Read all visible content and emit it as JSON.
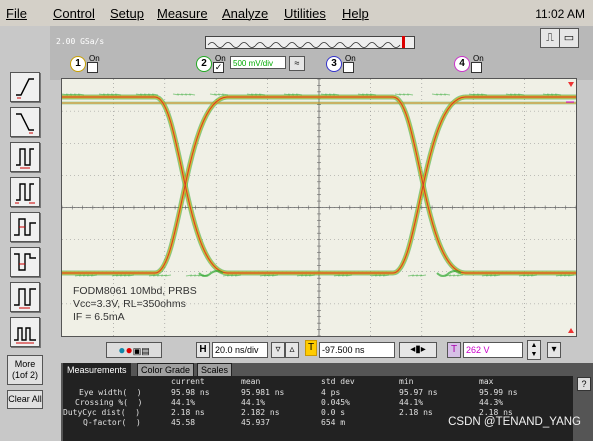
{
  "menu": [
    "File",
    "Control",
    "Setup",
    "Measure",
    "Analyze",
    "Utilities",
    "Help"
  ],
  "clock": "11:02 AM",
  "toolbar": {
    "sample_rate": "2.00 GSa/s",
    "channels": [
      {
        "num": "1",
        "on_label": "On",
        "checked": false
      },
      {
        "num": "2",
        "on_label": "On",
        "checked": true,
        "scale": "500 mV/div"
      },
      {
        "num": "3",
        "on_label": "On",
        "checked": false
      },
      {
        "num": "4",
        "on_label": "On",
        "checked": false
      }
    ]
  },
  "sidebar": {
    "more_label": "More (1of 2)",
    "clear_label": "Clear All"
  },
  "annotation": {
    "line1": "FODM8061 10Mbd, PRBS",
    "line2": "Vcc=3.3V, RL=350ohms",
    "line3": "IF = 6.5mA"
  },
  "controls": {
    "h_label": "H",
    "timebase": "20.0 ns/div",
    "delay": "-97.500 ns",
    "t_label": "T",
    "trigger_level": "262 V",
    "trigger_marker": "T"
  },
  "measurements": {
    "tabs": [
      "Measurements",
      "Color Grade",
      "Scales"
    ],
    "headers": [
      "current",
      "mean",
      "std dev",
      "min",
      "max"
    ],
    "rows": [
      {
        "label": "Eye width(  )",
        "values": [
          "95.98 ns",
          "95.981 ns",
          "4 ps",
          "95.97 ns",
          "95.99 ns"
        ]
      },
      {
        "label": "Crossing %(  )",
        "values": [
          "44.1%",
          "44.1%",
          "0.045%",
          "44.1%",
          "44.3%"
        ]
      },
      {
        "label": "DutyCyc dist(  )",
        "values": [
          "2.18 ns",
          "2.182 ns",
          "0.0 s",
          "2.18 ns",
          "2.18 ns"
        ]
      },
      {
        "label": "Q-factor(  )",
        "values": [
          "45.58",
          "45.937",
          "654 m",
          "",
          ""
        ]
      }
    ]
  },
  "watermark": "CSDN @TENAND_YANG",
  "colors": {
    "trace_green": "#2fa830",
    "trace_orange": "#e8b020",
    "trace_red": "#d03028",
    "grid": "#8a8a8a"
  }
}
